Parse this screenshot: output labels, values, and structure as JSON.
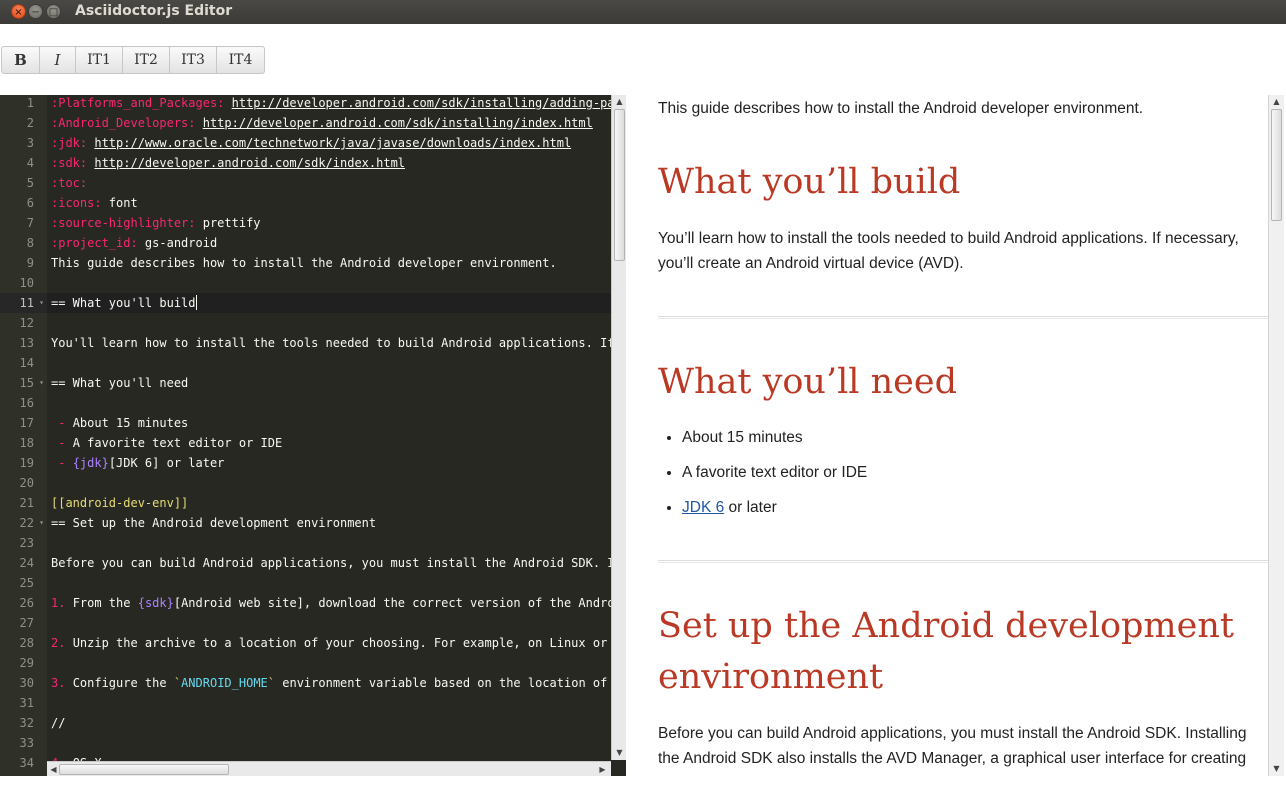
{
  "window": {
    "title": "Asciidoctor.js Editor",
    "close": "×",
    "minimize": "−",
    "maximize": "□"
  },
  "toolbar": {
    "bold": "B",
    "italic": "I",
    "h1": "IT1",
    "h2": "IT2",
    "h3": "IT3",
    "h4": "IT4"
  },
  "editor": {
    "lines": [
      {
        "n": "1",
        "segs": [
          [
            "k",
            ":Platforms_and_Packages: "
          ],
          [
            "u",
            "http://developer.android.com/sdk/installing/adding-packages.html"
          ]
        ]
      },
      {
        "n": "2",
        "segs": [
          [
            "k",
            ":Android_Developers: "
          ],
          [
            "u",
            "http://developer.android.com/sdk/installing/index.html"
          ]
        ]
      },
      {
        "n": "3",
        "segs": [
          [
            "k",
            ":jdk: "
          ],
          [
            "u",
            "http://www.oracle.com/technetwork/java/javase/downloads/index.html"
          ]
        ]
      },
      {
        "n": "4",
        "segs": [
          [
            "k",
            ":sdk: "
          ],
          [
            "u",
            "http://developer.android.com/sdk/index.html"
          ]
        ]
      },
      {
        "n": "5",
        "segs": [
          [
            "k",
            ":toc:"
          ]
        ]
      },
      {
        "n": "6",
        "segs": [
          [
            "k",
            ":icons: "
          ],
          [
            "t",
            "font"
          ]
        ]
      },
      {
        "n": "7",
        "segs": [
          [
            "k",
            ":source-highlighter: "
          ],
          [
            "t",
            "prettify"
          ]
        ]
      },
      {
        "n": "8",
        "segs": [
          [
            "k",
            ":project_id: "
          ],
          [
            "t",
            "gs-android"
          ]
        ]
      },
      {
        "n": "9",
        "segs": [
          [
            "t",
            "This guide describes how to install the Android developer environment."
          ]
        ]
      },
      {
        "n": "10",
        "segs": []
      },
      {
        "n": "11",
        "fold": true,
        "active": true,
        "cursor": true,
        "segs": [
          [
            "t",
            "== What you'll build"
          ]
        ]
      },
      {
        "n": "12",
        "segs": []
      },
      {
        "n": "13",
        "segs": [
          [
            "t",
            "You'll learn how to install the tools needed to build Android applications. If n"
          ]
        ]
      },
      {
        "n": "14",
        "segs": []
      },
      {
        "n": "15",
        "fold": true,
        "segs": [
          [
            "t",
            "== What you'll need"
          ]
        ]
      },
      {
        "n": "16",
        "segs": []
      },
      {
        "n": "17",
        "segs": [
          [
            "k",
            " - "
          ],
          [
            "t",
            "About 15 minutes"
          ]
        ]
      },
      {
        "n": "18",
        "segs": [
          [
            "k",
            " - "
          ],
          [
            "t",
            "A favorite text editor or IDE"
          ]
        ]
      },
      {
        "n": "19",
        "segs": [
          [
            "k",
            " - "
          ],
          [
            "v",
            "{jdk}"
          ],
          [
            "t",
            "[JDK 6] or later"
          ]
        ]
      },
      {
        "n": "20",
        "segs": []
      },
      {
        "n": "21",
        "segs": [
          [
            "y",
            "[[android-dev-env]]"
          ]
        ]
      },
      {
        "n": "22",
        "fold": true,
        "segs": [
          [
            "t",
            "== Set up the Android development environment"
          ]
        ]
      },
      {
        "n": "23",
        "segs": []
      },
      {
        "n": "24",
        "segs": [
          [
            "t",
            "Before you can build Android applications, you must install the Android SDK. Ins"
          ]
        ]
      },
      {
        "n": "25",
        "segs": []
      },
      {
        "n": "26",
        "segs": [
          [
            "k",
            "1. "
          ],
          [
            "t",
            "From the "
          ],
          [
            "v",
            "{sdk}"
          ],
          [
            "t",
            "[Android web site], download the correct version of the Android"
          ]
        ]
      },
      {
        "n": "27",
        "segs": []
      },
      {
        "n": "28",
        "segs": [
          [
            "k",
            "2. "
          ],
          [
            "t",
            "Unzip the archive to a location of your choosing. For example, on Linux or Ma"
          ]
        ]
      },
      {
        "n": "29",
        "segs": []
      },
      {
        "n": "30",
        "segs": [
          [
            "k",
            "3. "
          ],
          [
            "t",
            "Configure the "
          ],
          [
            "y",
            "`"
          ],
          [
            "c",
            "ANDROID_HOME"
          ],
          [
            "y",
            "`"
          ],
          [
            "t",
            " environment variable based on the location of th"
          ]
        ]
      },
      {
        "n": "31",
        "segs": []
      },
      {
        "n": "32",
        "segs": [
          [
            "t",
            "//"
          ]
        ]
      },
      {
        "n": "33",
        "segs": []
      },
      {
        "n": "34",
        "segs": [
          [
            "k",
            "4. "
          ],
          [
            "t",
            "OS X"
          ]
        ]
      }
    ]
  },
  "preview": {
    "intro": "This guide describes how to install the Android developer environment.",
    "h_build": "What you’ll build",
    "p_build": "You’ll learn how to install the tools needed to build Android applications. If necessary, you’ll create an Android virtual device (AVD).",
    "h_need": "What you’ll need",
    "need_items": [
      "About 15 minutes",
      "A favorite text editor or IDE"
    ],
    "need_link": "JDK 6",
    "need_link_suffix": " or later",
    "h_setup": "Set up the Android development environment",
    "p_setup": "Before you can build Android applications, you must install the Android SDK. Installing the Android SDK also installs the AVD Manager, a graphical user interface for creating"
  },
  "colors": {
    "heading": "#ba3925",
    "link": "#2156a5",
    "editor_bg": "#272822",
    "keyword": "#f92672"
  }
}
